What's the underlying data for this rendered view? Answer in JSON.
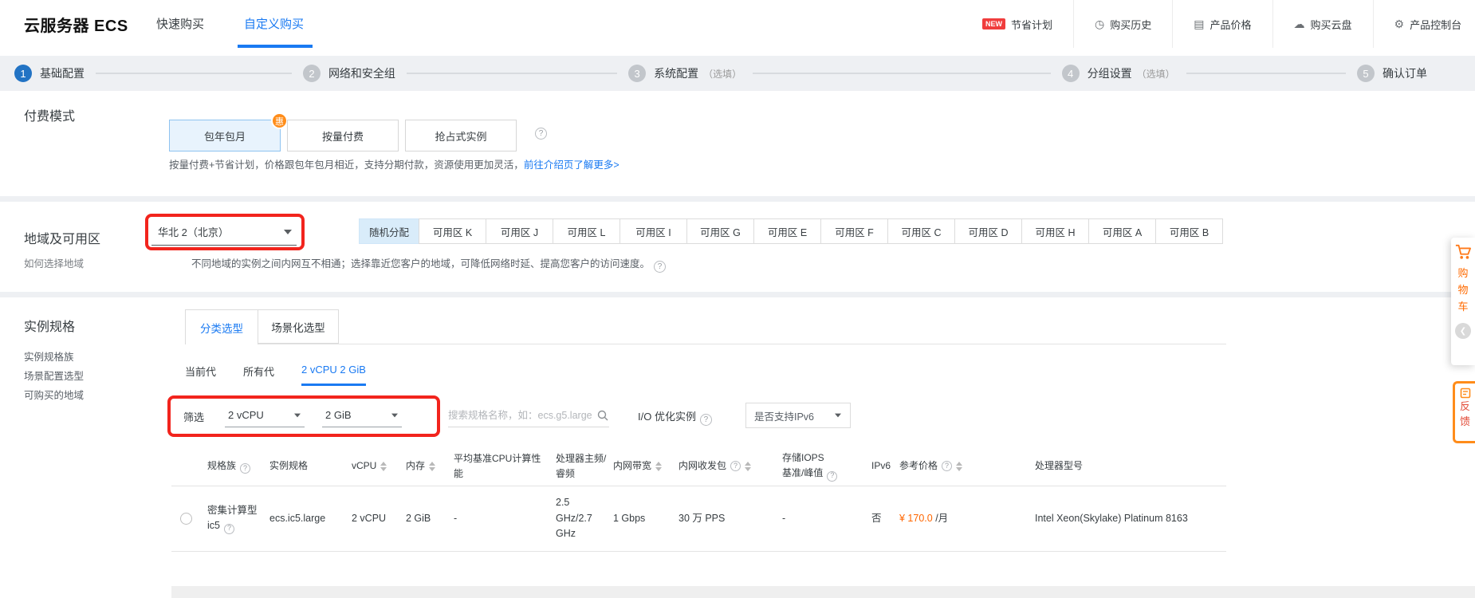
{
  "icons": {
    "help": "?",
    "clock": "◷",
    "price_doc": "▤",
    "cloud_disk": "☁",
    "gear": "⚙",
    "chevron_left": "❮"
  },
  "header": {
    "title": "云服务器 ECS",
    "tabs": [
      {
        "label": "快速购买"
      },
      {
        "label": "自定义购买"
      }
    ],
    "nav": [
      {
        "badge": "NEW",
        "label": "节省计划"
      },
      {
        "icon": "clock-icon",
        "label": "购买历史"
      },
      {
        "icon": "price-doc-icon",
        "label": "产品价格"
      },
      {
        "icon": "cloud-disk-icon",
        "label": "购买云盘"
      },
      {
        "icon": "console-gear-icon",
        "label": "产品控制台"
      }
    ]
  },
  "steps": [
    {
      "num": "1",
      "label": "基础配置",
      "note": ""
    },
    {
      "num": "2",
      "label": "网络和安全组",
      "note": ""
    },
    {
      "num": "3",
      "label": "系统配置",
      "note": "（选填）"
    },
    {
      "num": "4",
      "label": "分组设置",
      "note": "（选填）"
    },
    {
      "num": "5",
      "label": "确认订单",
      "note": ""
    }
  ],
  "payment": {
    "label": "付费模式",
    "options": [
      {
        "label": "包年包月",
        "badge": "惠"
      },
      {
        "label": "按量付费"
      },
      {
        "label": "抢占式实例"
      }
    ],
    "description": "按量付费+节省计划，价格跟包年包月相近，支持分期付款，资源使用更加灵活，",
    "description_link": "前往介绍页了解更多>"
  },
  "region": {
    "label": "地域及可用区",
    "help_link": "如何选择地域",
    "selected_region": "华北 2（北京）",
    "zones": [
      "随机分配",
      "可用区 K",
      "可用区 J",
      "可用区 L",
      "可用区 I",
      "可用区 G",
      "可用区 E",
      "可用区 F",
      "可用区 C",
      "可用区 D",
      "可用区 H",
      "可用区 A",
      "可用区 B"
    ],
    "selected_zone": "随机分配",
    "hint": "不同地域的实例之间内网互不相通；选择靠近您客户的地域，可降低网络时延、提高您客户的访问速度。"
  },
  "spec": {
    "label": "实例规格",
    "side_links": [
      "实例规格族",
      "场景配置选型",
      "可购买的地域"
    ],
    "tabs": [
      {
        "label": "分类选型"
      },
      {
        "label": "场景化选型"
      }
    ],
    "gen_tabs": [
      {
        "label": "当前代"
      },
      {
        "label": "所有代"
      },
      {
        "label": "2 vCPU 2 GiB"
      }
    ],
    "filter": {
      "label": "筛选",
      "vcpu_value": "2 vCPU",
      "mem_value": "2 GiB",
      "search_placeholder": "搜索规格名称，如：ecs.g5.large",
      "io_label": "I/O 优化实例",
      "ipv6_value": "是否支持IPv6"
    },
    "table": {
      "columns": [
        {
          "label": "规格族"
        },
        {
          "label": "实例规格"
        },
        {
          "label": "vCPU"
        },
        {
          "label": "内存"
        },
        {
          "label": "平均基准CPU计算性能"
        },
        {
          "label": "处理器主频/睿频"
        },
        {
          "label": "内网带宽"
        },
        {
          "label": "内网收发包"
        },
        {
          "label": "存储IOPS",
          "line2": "基准/峰值"
        },
        {
          "label": "IPv6"
        },
        {
          "label": "参考价格"
        },
        {
          "label": "处理器型号"
        }
      ],
      "row": {
        "family": "密集计算型 ic5",
        "instance": "ecs.ic5.large",
        "vcpu": "2 vCPU",
        "mem": "2 GiB",
        "baseline": "-",
        "freq": "2.5 GHz/2.7 GHz",
        "bandwidth": "1 Gbps",
        "pps": "30 万 PPS",
        "iops": "-",
        "ipv6": "否",
        "price": "¥ 170.0",
        "price_unit": "/月",
        "cpu_model": "Intel Xeon(Skylake) Platinum 8163"
      }
    }
  },
  "floating": {
    "cart_chars": [
      "购",
      "物",
      "车"
    ],
    "feedback_chars": [
      "反",
      "馈"
    ]
  },
  "colors": {
    "accent_blue": "#1a7af2",
    "step_blue": "#2273c4",
    "highlight_red": "#f2241d",
    "price_orange": "#ff6600",
    "badge_orange": "#ff8d1a",
    "new_red": "#f03d3d",
    "selected_payment_bg": "#e8f3fd",
    "selected_zone_bg": "#d9ecfa"
  }
}
